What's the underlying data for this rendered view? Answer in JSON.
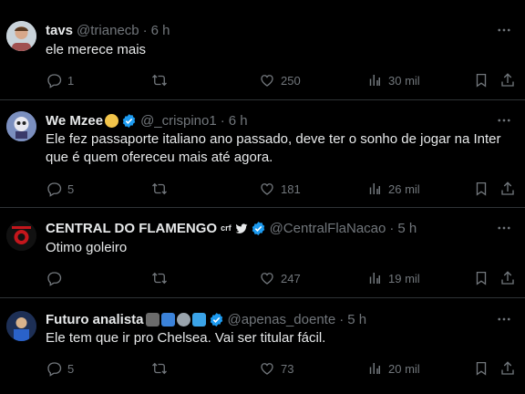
{
  "tweets": [
    {
      "name": "tavs",
      "handle": "@trianecb",
      "time": "6 h",
      "text": "ele merece mais",
      "replies": "1",
      "retweets": "",
      "likes": "250",
      "views": "30 mil"
    },
    {
      "name": "We Mzee",
      "handle": "@_crispino1",
      "time": "6 h",
      "text": "Ele fez passaporte italiano ano passado, deve ter o sonho de jogar na Inter que é quem ofereceu mais até agora.",
      "replies": "5",
      "retweets": "",
      "likes": "181",
      "views": "26 mil"
    },
    {
      "name": "CENTRAL DO FLAMENGO",
      "handle": "@CentralFlaNacao",
      "time": "5 h",
      "text": "Otimo goleiro",
      "replies": "",
      "retweets": "",
      "likes": "247",
      "views": "19 mil"
    },
    {
      "name": "Futuro analista",
      "handle": "@apenas_doente",
      "time": "5 h",
      "text": "Ele tem que ir pro Chelsea. Vai ser titular fácil.",
      "replies": "5",
      "retweets": "",
      "likes": "73",
      "views": "20 mil"
    }
  ],
  "colors": {
    "background": "#000000",
    "text": "#e7e9ea",
    "muted": "#71767b",
    "divider": "#2f3336",
    "verified": "#1d9bf0"
  },
  "icons": [
    "reply-icon",
    "retweet-icon",
    "like-icon",
    "views-icon",
    "bookmark-icon",
    "share-icon",
    "more-icon",
    "verified-icon"
  ]
}
